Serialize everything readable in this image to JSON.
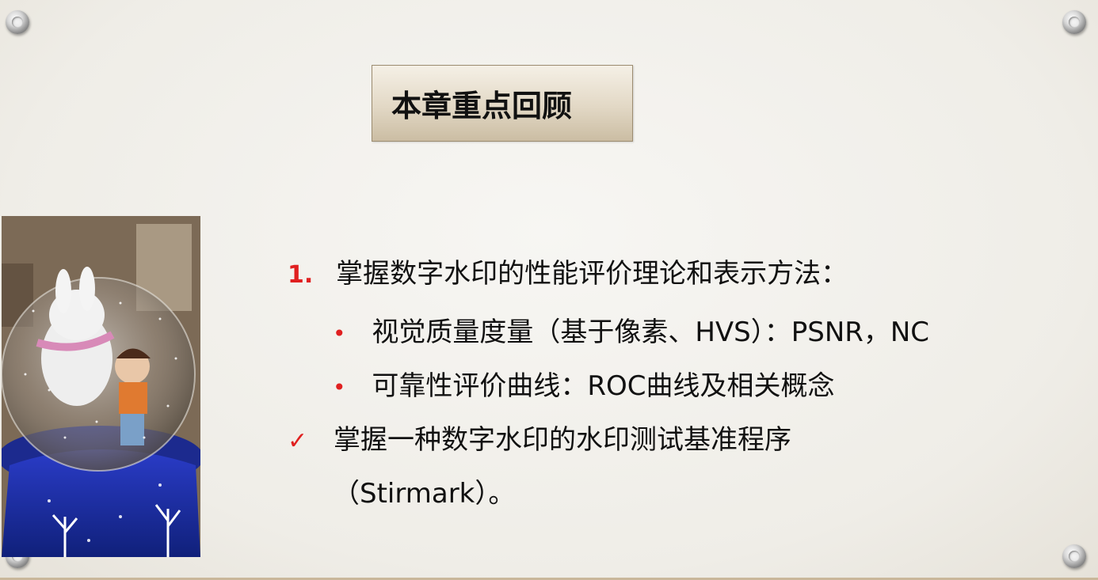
{
  "slide": {
    "title": "本章重点回顾",
    "items": [
      {
        "marker": "1.",
        "text": "掌握数字水印的性能评价理论和表示方法："
      },
      {
        "marker": "•",
        "text": "视觉质量度量（基于像素、HVS）：PSNR，NC"
      },
      {
        "marker": "•",
        "text": "可靠性评价曲线：ROC曲线及相关概念"
      },
      {
        "marker": "✓",
        "text": "掌握一种数字水印的水印测试基准程序"
      },
      {
        "marker": "",
        "text": "（Stirmark）。"
      }
    ]
  },
  "photo": {
    "description_icon": "snow-globe-photo"
  },
  "colors": {
    "accent": "#e02020",
    "title_bg": "#e2d8c5",
    "page_bg": "#f1efe9"
  }
}
